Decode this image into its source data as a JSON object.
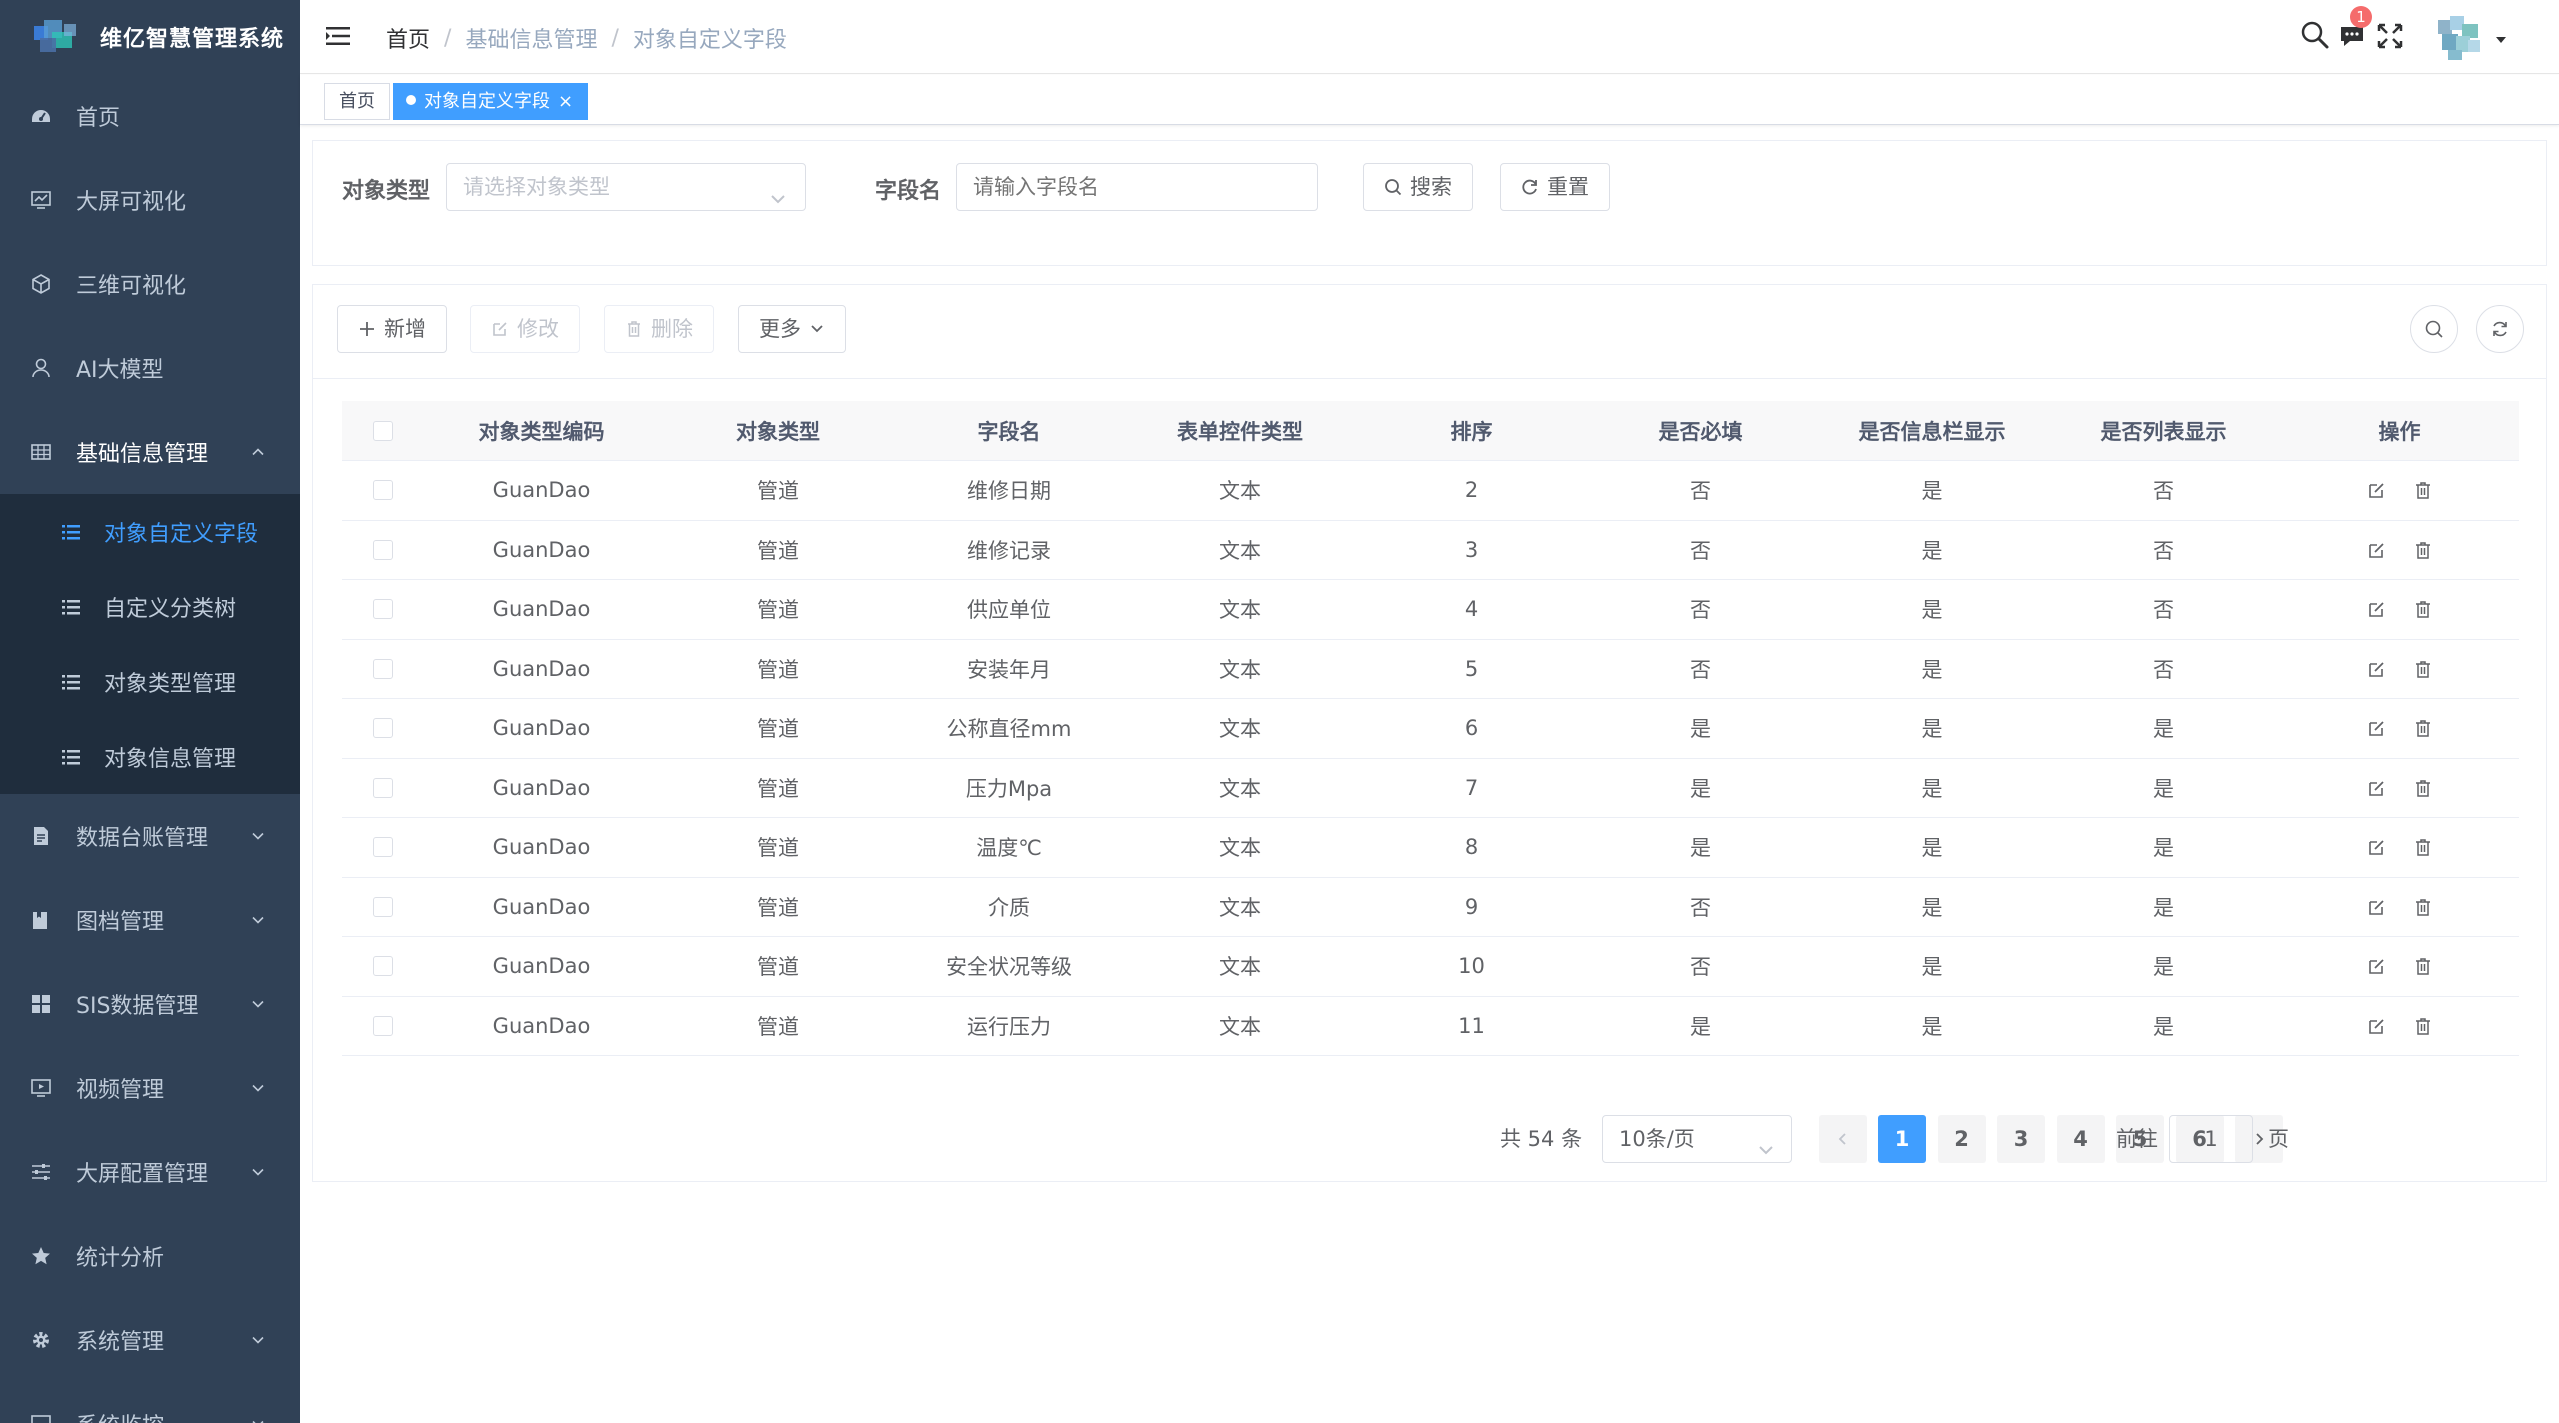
{
  "app": {
    "title": "维亿智慧管理系统"
  },
  "sidebar": {
    "items": [
      {
        "label": "首页",
        "icon": "dashboard-icon",
        "has_arrow": false
      },
      {
        "label": "大屏可视化",
        "icon": "monitor-chart-icon",
        "has_arrow": false
      },
      {
        "label": "三维可视化",
        "icon": "cube-icon",
        "has_arrow": false
      },
      {
        "label": "AI大模型",
        "icon": "user-icon",
        "has_arrow": false
      },
      {
        "label": "基础信息管理",
        "icon": "table-icon",
        "has_arrow": true,
        "expanded": true
      },
      {
        "label": "数据台账管理",
        "icon": "document-icon",
        "has_arrow": true
      },
      {
        "label": "图档管理",
        "icon": "folder-icon",
        "has_arrow": true
      },
      {
        "label": "SIS数据管理",
        "icon": "grid-icon",
        "has_arrow": true
      },
      {
        "label": "视频管理",
        "icon": "video-monitor-icon",
        "has_arrow": true
      },
      {
        "label": "大屏配置管理",
        "icon": "sliders-icon",
        "has_arrow": true
      },
      {
        "label": "统计分析",
        "icon": "star-icon",
        "has_arrow": false
      },
      {
        "label": "系统管理",
        "icon": "gear-icon",
        "has_arrow": true
      },
      {
        "label": "系统监控",
        "icon": "monitor-icon",
        "has_arrow": true
      }
    ],
    "submenu": [
      {
        "label": "对象自定义字段",
        "active": true
      },
      {
        "label": "自定义分类树",
        "active": false
      },
      {
        "label": "对象类型管理",
        "active": false
      },
      {
        "label": "对象信息管理",
        "active": false
      }
    ]
  },
  "header": {
    "breadcrumb": [
      "首页",
      "基础信息管理",
      "对象自定义字段"
    ],
    "notification_count": "1"
  },
  "tags": {
    "home": "首页",
    "active": "对象自定义字段",
    "close": "×"
  },
  "search": {
    "type_label": "对象类型",
    "type_placeholder": "请选择对象类型",
    "field_label": "字段名",
    "field_placeholder": "请输入字段名",
    "search_button": "搜索",
    "reset_button": "重置"
  },
  "toolbar": {
    "add": "新增",
    "edit": "修改",
    "delete": "删除",
    "more": "更多"
  },
  "table": {
    "columns": [
      "对象类型编码",
      "对象类型",
      "字段名",
      "表单控件类型",
      "排序",
      "是否必填",
      "是否信息栏显示",
      "是否列表显示",
      "操作"
    ],
    "rows": [
      [
        "GuanDao",
        "管道",
        "维修日期",
        "文本",
        "2",
        "否",
        "是",
        "否"
      ],
      [
        "GuanDao",
        "管道",
        "维修记录",
        "文本",
        "3",
        "否",
        "是",
        "否"
      ],
      [
        "GuanDao",
        "管道",
        "供应单位",
        "文本",
        "4",
        "否",
        "是",
        "否"
      ],
      [
        "GuanDao",
        "管道",
        "安装年月",
        "文本",
        "5",
        "否",
        "是",
        "否"
      ],
      [
        "GuanDao",
        "管道",
        "公称直径mm",
        "文本",
        "6",
        "是",
        "是",
        "是"
      ],
      [
        "GuanDao",
        "管道",
        "压力Mpa",
        "文本",
        "7",
        "是",
        "是",
        "是"
      ],
      [
        "GuanDao",
        "管道",
        "温度℃",
        "文本",
        "8",
        "是",
        "是",
        "是"
      ],
      [
        "GuanDao",
        "管道",
        "介质",
        "文本",
        "9",
        "否",
        "是",
        "是"
      ],
      [
        "GuanDao",
        "管道",
        "安全状况等级",
        "文本",
        "10",
        "否",
        "是",
        "是"
      ],
      [
        "GuanDao",
        "管道",
        "运行压力",
        "文本",
        "11",
        "是",
        "是",
        "是"
      ]
    ]
  },
  "pagination": {
    "total": "共 54 条",
    "page_size": "10条/页",
    "pages": [
      "1",
      "2",
      "3",
      "4",
      "5",
      "6"
    ],
    "current": "1",
    "goto_label": "前往",
    "goto_value": "1",
    "goto_unit": "页"
  },
  "colors": {
    "sidebar_bg": "#304156",
    "submenu_bg": "#1f2d3d",
    "accent": "#409eff"
  }
}
